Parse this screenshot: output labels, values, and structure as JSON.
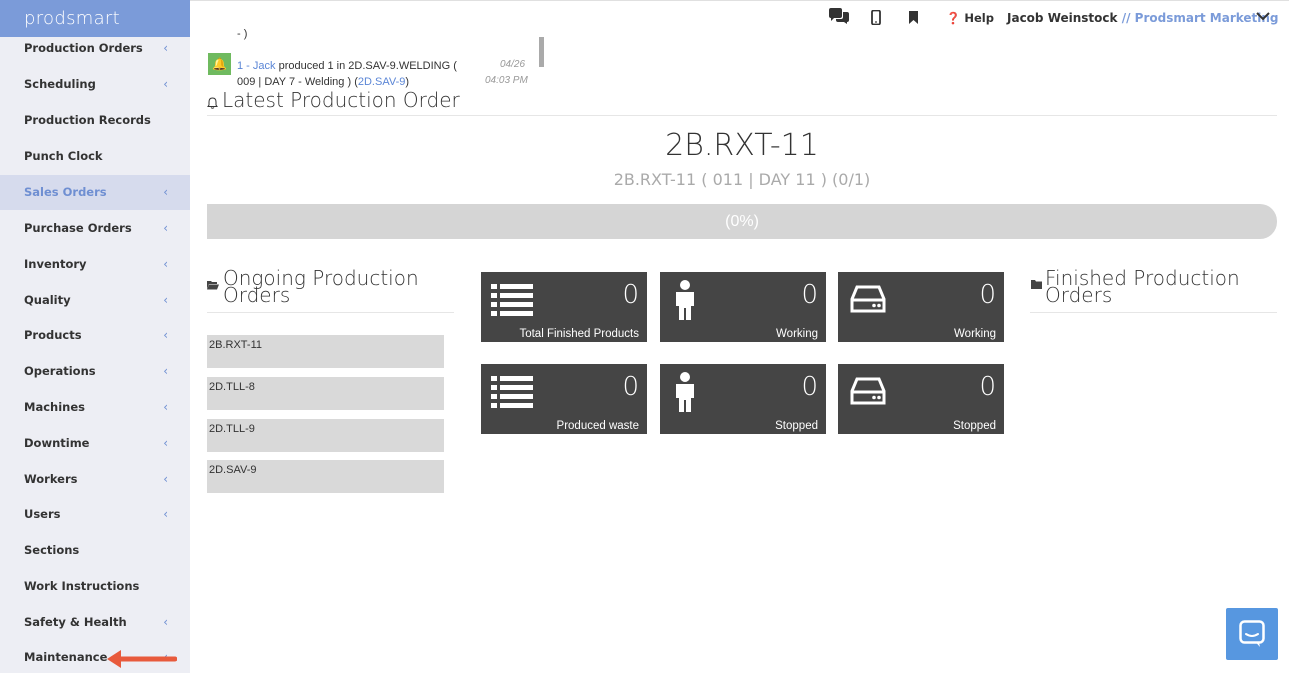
{
  "app": {
    "brand": "prodsmart"
  },
  "sidebar": {
    "items": [
      {
        "label": "Production Orders",
        "chevron": "‹"
      },
      {
        "label": "Scheduling",
        "chevron": "‹"
      },
      {
        "label": "Production Records",
        "chevron": ""
      },
      {
        "label": "Punch Clock",
        "chevron": ""
      },
      {
        "label": "Sales Orders",
        "chevron": "‹"
      },
      {
        "label": "Purchase Orders",
        "chevron": "‹"
      },
      {
        "label": "Inventory",
        "chevron": "‹"
      },
      {
        "label": "Quality",
        "chevron": "‹"
      },
      {
        "label": "Products",
        "chevron": "‹"
      },
      {
        "label": "Operations",
        "chevron": "‹"
      },
      {
        "label": "Machines",
        "chevron": "‹"
      },
      {
        "label": "Downtime",
        "chevron": "‹"
      },
      {
        "label": "Workers",
        "chevron": "‹"
      },
      {
        "label": "Users",
        "chevron": "‹"
      },
      {
        "label": "Sections",
        "chevron": ""
      },
      {
        "label": "Work Instructions",
        "chevron": ""
      },
      {
        "label": "Safety & Health",
        "chevron": "‹"
      },
      {
        "label": "Maintenance",
        "chevron": "‹"
      }
    ]
  },
  "topbar": {
    "help": "Help",
    "user_name": "Jacob Weinstock",
    "separator": "//",
    "org": "Prodsmart Marketing"
  },
  "notification": {
    "top_fragment": "- )",
    "link": "1 - Jack",
    "text": " produced 1 in 2D.SAV-9.WELDING (",
    "line2": "009 | DAY 7 - Welding ) (",
    "line2_link": "2D.SAV-9",
    "line2_end": ")",
    "date": "04/26",
    "time": "04:03 PM"
  },
  "latest": {
    "title": "Latest Production Order",
    "code": "2B.RXT-11",
    "subtitle": "2B.RXT-11 ( 011 | DAY 11 ) (0/1)",
    "progress_label": "(0%)",
    "progress_fraction": 0
  },
  "ongoing": {
    "title_line1": "Ongoing Production",
    "title_line2": "Orders",
    "orders": [
      "2B.RXT-11",
      "2D.TLL-8",
      "2D.TLL-9",
      "2D.SAV-9"
    ]
  },
  "finished": {
    "title_line1": "Finished Production",
    "title_line2": "Orders"
  },
  "tiles": [
    {
      "value": "0",
      "label": "Total Finished Products",
      "icon": "list-icon"
    },
    {
      "value": "0",
      "label": "Working",
      "icon": "person-icon"
    },
    {
      "value": "0",
      "label": "Working",
      "icon": "hdd-icon"
    },
    {
      "value": "0",
      "label": "Produced waste",
      "icon": "list-icon"
    },
    {
      "value": "0",
      "label": "Stopped",
      "icon": "person-icon"
    },
    {
      "value": "0",
      "label": "Stopped",
      "icon": "hdd-icon"
    }
  ],
  "colors": {
    "brand": "#7b9bd9",
    "sidebar_bg": "#edeef4",
    "tile_bg": "#454545",
    "progress_bg": "#d5d5d5",
    "chat_button": "#5797e0"
  }
}
